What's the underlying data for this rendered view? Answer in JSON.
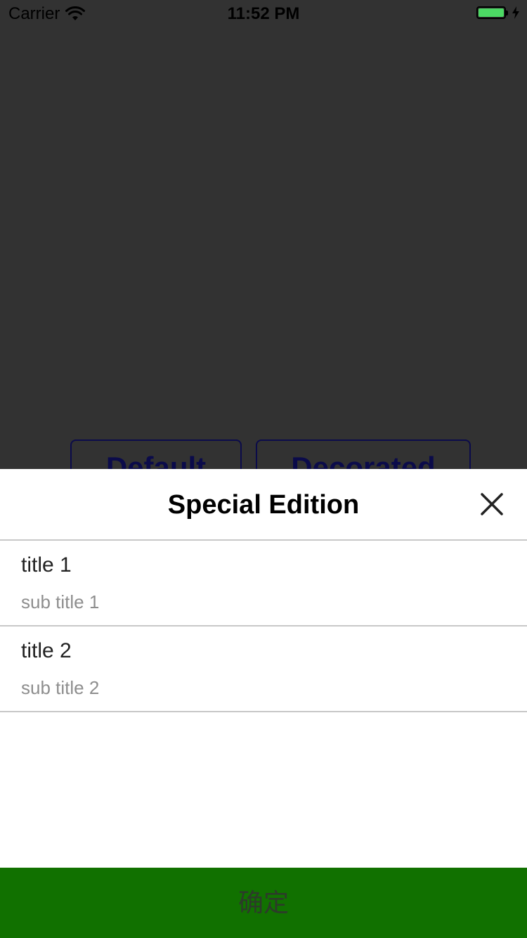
{
  "status_bar": {
    "carrier": "Carrier",
    "time": "11:52 PM",
    "wifi_icon": "wifi-icon",
    "battery_icon": "battery-icon",
    "charging_icon": "bolt-icon",
    "battery_color": "#4cd964",
    "battery_level": 1.0
  },
  "background": {
    "color": "#323232",
    "buttons": [
      {
        "label": "Default"
      },
      {
        "label": "Decorated"
      }
    ]
  },
  "sheet": {
    "title": "Special Edition",
    "close_icon": "close-icon",
    "items": [
      {
        "title": "title 1",
        "subtitle": "sub title 1"
      },
      {
        "title": "title 2",
        "subtitle": "sub title 2"
      }
    ],
    "confirm_label": "确定",
    "confirm_color": "#117100"
  }
}
